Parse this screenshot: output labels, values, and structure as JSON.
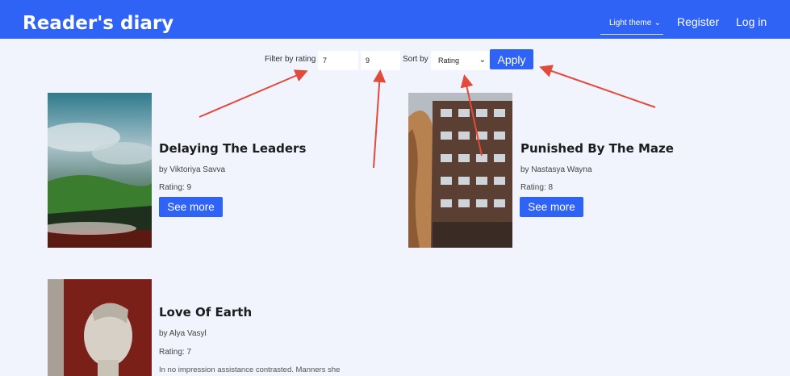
{
  "header": {
    "brand": "Reader's diary",
    "theme_select": "Light theme",
    "register": "Register",
    "login": "Log in"
  },
  "filter": {
    "label": "Filter by rating",
    "min_value": "7",
    "max_value": "9",
    "sort_label": "Sort by",
    "sort_value": "Rating",
    "apply_label": "Apply"
  },
  "books": [
    {
      "title": "Delaying The Leaders",
      "author": "by Viktoriya Savva",
      "rating": "Rating: 9",
      "button": "See more"
    },
    {
      "title": "Punished By The Maze",
      "author": "by Nastasya Wayna",
      "rating": "Rating: 8",
      "button": "See more"
    },
    {
      "title": "Love Of Earth",
      "author": "by Alya Vasyl",
      "rating": "Rating: 7",
      "description": "In no impression assistance contrasted. Manners she"
    }
  ],
  "colors": {
    "nav": "#2f63f5",
    "background": "#f1f3fd",
    "arrow": "#e24a3b"
  }
}
